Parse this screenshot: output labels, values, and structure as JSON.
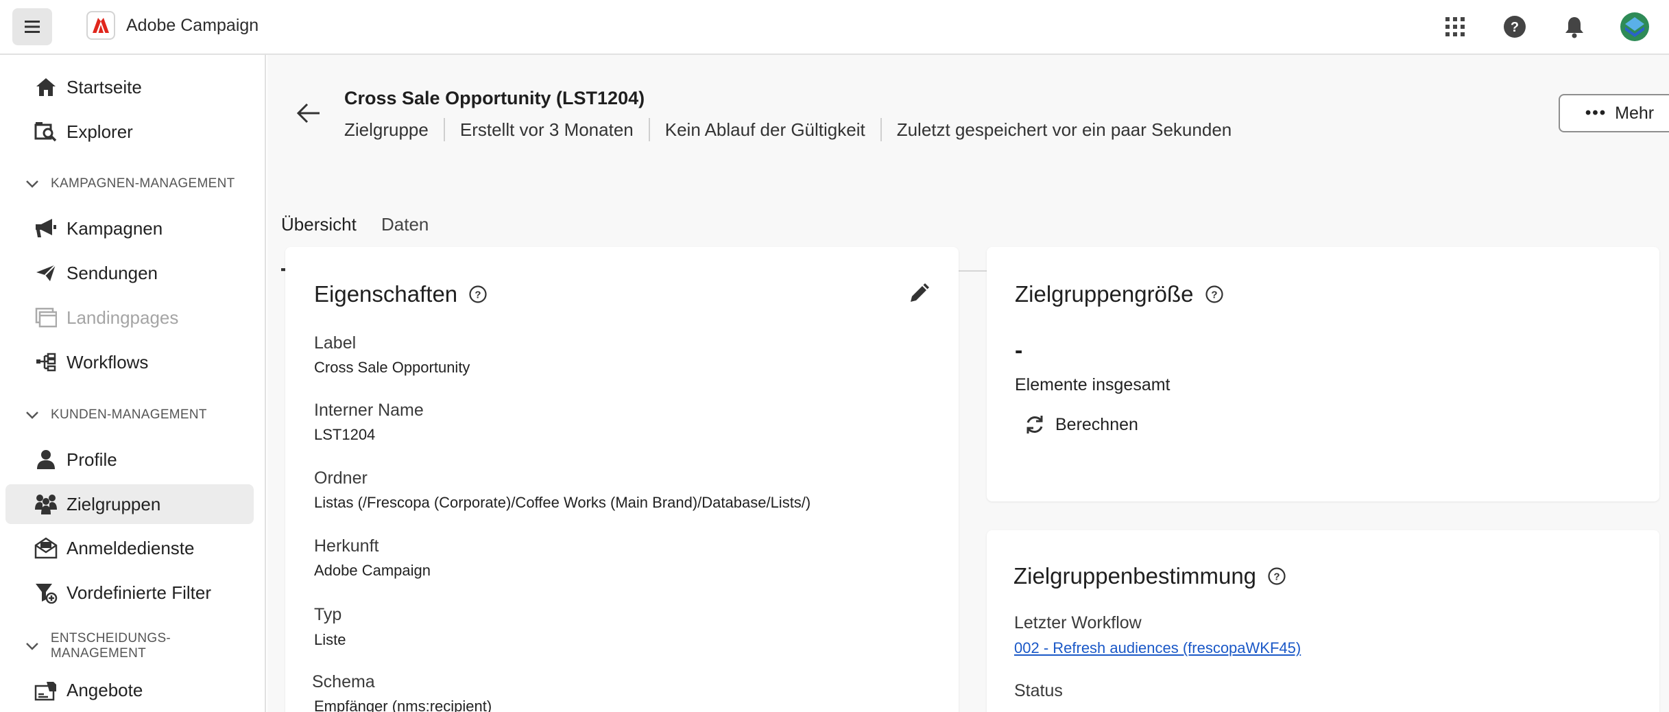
{
  "app": {
    "name": "Adobe Campaign"
  },
  "topbar": {
    "icons": [
      "apps-grid-icon",
      "help-icon",
      "notifications-bell-icon",
      "user-avatar"
    ]
  },
  "sidebar": {
    "items_top": [
      {
        "label": "Startseite",
        "icon": "home-icon"
      },
      {
        "label": "Explorer",
        "icon": "explorer-icon"
      }
    ],
    "sections": [
      {
        "title": "KAMPAGNEN-MANAGEMENT",
        "items": [
          {
            "label": "Kampagnen",
            "icon": "megaphone-icon"
          },
          {
            "label": "Sendungen",
            "icon": "send-icon"
          },
          {
            "label": "Landingpages",
            "icon": "landing-page-icon",
            "disabled": true
          },
          {
            "label": "Workflows",
            "icon": "workflow-icon"
          }
        ]
      },
      {
        "title": "KUNDEN-MANAGEMENT",
        "items": [
          {
            "label": "Profile",
            "icon": "profile-icon"
          },
          {
            "label": "Zielgruppen",
            "icon": "audiences-icon",
            "active": true
          },
          {
            "label": "Anmeldedienste",
            "icon": "subscription-icon"
          },
          {
            "label": "Vordefinierte Filter",
            "icon": "filter-icon"
          }
        ]
      },
      {
        "title": "ENTSCHEIDUNGS-MANAGEMENT",
        "items": [
          {
            "label": "Angebote",
            "icon": "offers-icon"
          }
        ]
      }
    ]
  },
  "header": {
    "title": "Cross Sale Opportunity (LST1204)",
    "meta": [
      "Zielgruppe",
      "Erstellt vor 3 Monaten",
      "Kein Ablauf der Gültigkeit",
      "Zuletzt gespeichert vor ein paar Sekunden"
    ],
    "more_label": "Mehr"
  },
  "tabs": [
    {
      "label": "Übersicht",
      "active": true
    },
    {
      "label": "Daten",
      "active": false
    }
  ],
  "properties": {
    "title": "Eigenschaften",
    "fields": [
      {
        "label": "Label",
        "value": "Cross Sale Opportunity"
      },
      {
        "label": "Interner Name",
        "value": "LST1204"
      },
      {
        "label": "Ordner",
        "value": "Listas (/Frescopa (Corporate)/Coffee Works (Main Brand)/Database/Lists/)"
      },
      {
        "label": "Herkunft",
        "value": "Adobe Campaign"
      },
      {
        "label": "Typ",
        "value": "Liste"
      },
      {
        "label": "Schema",
        "value": "Empfänger (nms:recipient)"
      }
    ]
  },
  "audience_size": {
    "title": "Zielgruppengröße",
    "value": "-",
    "caption": "Elemente insgesamt",
    "compute_label": "Berechnen"
  },
  "targeting": {
    "title": "Zielgruppenbestimmung",
    "last_workflow_label": "Letzter Workflow",
    "last_workflow_link": "002 - Refresh audiences (frescopaWKF45)",
    "status_label": "Status"
  }
}
